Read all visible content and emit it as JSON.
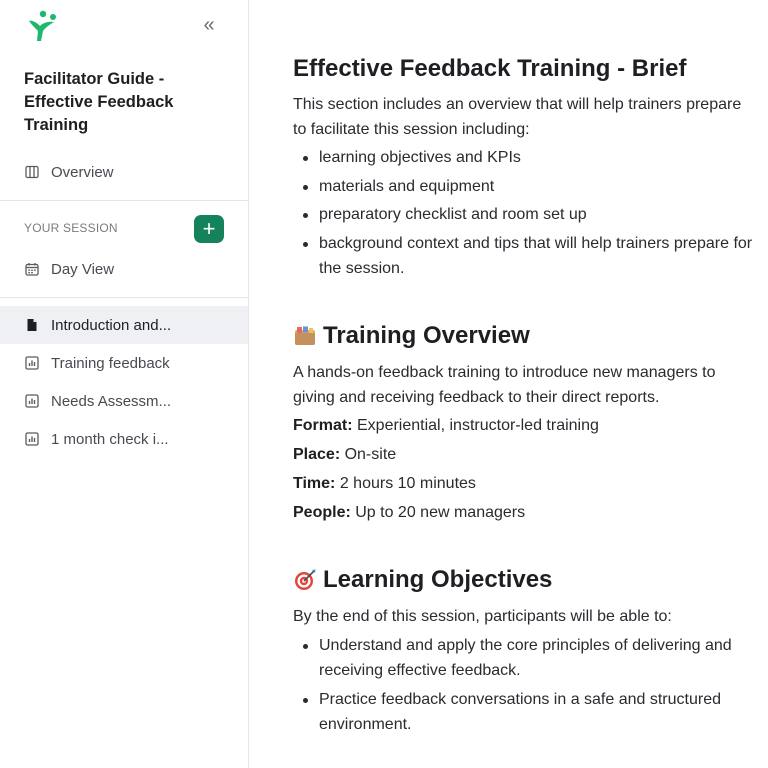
{
  "sidebar": {
    "doc_title": "Facilitator Guide - Effective Feedback Training",
    "overview_label": "Overview",
    "section_label": "YOUR SESSION",
    "add_label": "+",
    "day_view_label": "Day View",
    "pages": [
      {
        "label": "Introduction and...",
        "icon": "document-icon",
        "active": true
      },
      {
        "label": "Training feedback",
        "icon": "chart-icon",
        "active": false
      },
      {
        "label": "Needs Assessm...",
        "icon": "chart-icon",
        "active": false
      },
      {
        "label": "1 month check i...",
        "icon": "chart-icon",
        "active": false
      }
    ],
    "accent_color": "#14835c"
  },
  "main": {
    "brief": {
      "title": "Effective Feedback Training - Brief",
      "intro": "This section includes an overview that will help trainers prepare to facilitate this session including:",
      "items": [
        "learning objectives and KPIs",
        "materials and equipment",
        "preparatory checklist and room set up",
        "background context and tips that will help trainers prepare for the session."
      ]
    },
    "overview": {
      "title": "Training Overview",
      "icon": "card-index-icon",
      "intro": "A hands-on feedback training to introduce new managers to giving and receiving feedback to their direct reports.",
      "fields": [
        {
          "label": "Format:",
          "value": " Experiential, instructor-led training"
        },
        {
          "label": "Place:",
          "value": " On-site"
        },
        {
          "label": "Time:",
          "value": " 2 hours 10 minutes"
        },
        {
          "label": "People:",
          "value": " Up to 20 new managers"
        }
      ]
    },
    "objectives": {
      "title": "Learning Objectives",
      "icon": "target-icon",
      "intro": "By the end of this session, participants will be able to:",
      "items": [
        "Understand and apply the core principles of delivering and receiving effective feedback.",
        "Practice feedback conversations in a safe and structured environment."
      ]
    }
  }
}
